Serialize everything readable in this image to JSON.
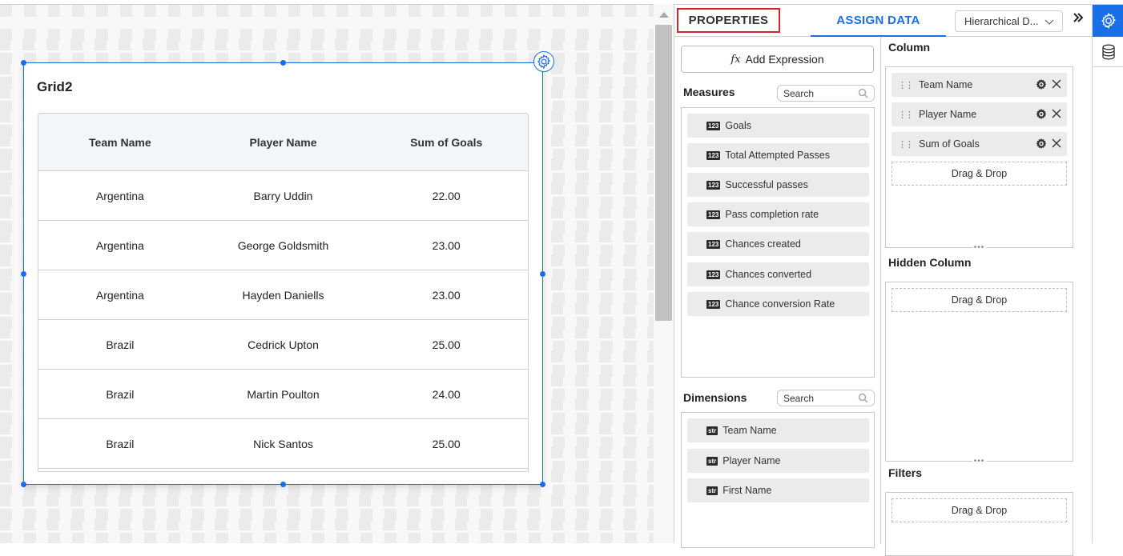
{
  "widget": {
    "title": "Grid2",
    "grid": {
      "columns": [
        "Team Name",
        "Player Name",
        "Sum of Goals"
      ],
      "rows": [
        [
          "Argentina",
          "Barry Uddin",
          "22.00"
        ],
        [
          "Argentina",
          "George Goldsmith",
          "23.00"
        ],
        [
          "Argentina",
          "Hayden Daniells",
          "23.00"
        ],
        [
          "Brazil",
          "Cedrick Upton",
          "25.00"
        ],
        [
          "Brazil",
          "Martin Poulton",
          "24.00"
        ],
        [
          "Brazil",
          "Nick Santos",
          "25.00"
        ]
      ]
    }
  },
  "panel": {
    "tabs": {
      "properties": "PROPERTIES",
      "assign_data": "ASSIGN DATA"
    },
    "datasource_select": "Hierarchical D...",
    "expand_icon": "double-chevron-right-icon",
    "add_expression": {
      "icon": "fx",
      "label": "Add Expression"
    },
    "measures": {
      "title": "Measures",
      "search_placeholder": "Search",
      "items": [
        {
          "badge": "123",
          "label": "Goals"
        },
        {
          "badge": "123",
          "label": "Total Attempted Passes"
        },
        {
          "badge": "123",
          "label": "Successful passes"
        },
        {
          "badge": "123",
          "label": "Pass completion rate"
        },
        {
          "badge": "123",
          "label": "Chances created"
        },
        {
          "badge": "123",
          "label": "Chances converted"
        },
        {
          "badge": "123",
          "label": "Chance conversion Rate"
        }
      ]
    },
    "dimensions": {
      "title": "Dimensions",
      "search_placeholder": "Search",
      "items": [
        {
          "badge": "str",
          "label": "Team Name"
        },
        {
          "badge": "str",
          "label": "Player Name"
        },
        {
          "badge": "str",
          "label": "First Name"
        }
      ]
    },
    "column": {
      "title": "Column",
      "items": [
        "Team Name",
        "Player Name",
        "Sum of Goals"
      ],
      "drop_label": "Drag & Drop"
    },
    "hidden_column": {
      "title": "Hidden Column",
      "drop_label": "Drag & Drop"
    },
    "filters": {
      "title": "Filters",
      "drop_label": "Drag & Drop"
    }
  },
  "side_tools": [
    "settings-icon",
    "database-icon"
  ],
  "colors": {
    "accent": "#1a6ee8",
    "highlight_border": "#d9232e"
  }
}
